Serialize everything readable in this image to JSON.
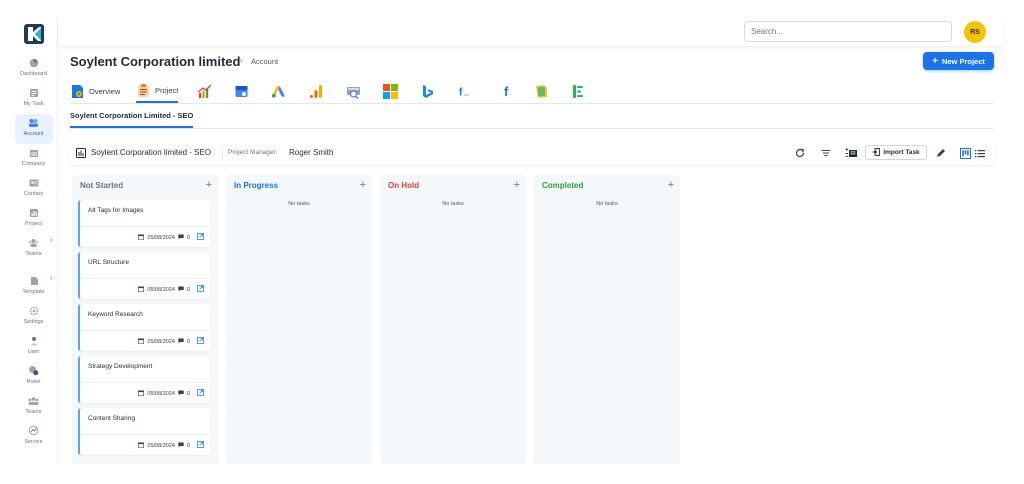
{
  "sidebar": {
    "items": [
      {
        "label": "Dashboard",
        "icon": "dashboard-icon"
      },
      {
        "label": "My Task",
        "icon": "task-list-icon"
      },
      {
        "label": "Account",
        "icon": "account-icon",
        "active": true
      },
      {
        "label": "Company",
        "icon": "company-icon"
      },
      {
        "label": "Contact",
        "icon": "contact-icon"
      },
      {
        "label": "Project",
        "icon": "project-icon"
      },
      {
        "label": "Teams",
        "icon": "teams-icon",
        "expandable": true
      },
      {
        "label": "Template",
        "icon": "template-icon",
        "expandable": true
      },
      {
        "label": "Settings",
        "icon": "settings-icon"
      },
      {
        "label": "User",
        "icon": "user-icon"
      },
      {
        "label": "Roles",
        "icon": "roles-icon"
      },
      {
        "label": "Teams",
        "icon": "teams-group-icon"
      },
      {
        "label": "Service",
        "icon": "service-icon"
      }
    ]
  },
  "header": {
    "search_placeholder": "Search...",
    "avatar_initials": "RS"
  },
  "page": {
    "title": "Soylent Corporation limited",
    "breadcrumb": "Account",
    "new_project_label": "New Project"
  },
  "tabs": [
    {
      "label": "Overview",
      "icon": "overview-icon"
    },
    {
      "label": "Project",
      "icon": "project-clipboard-icon",
      "active": true
    }
  ],
  "integration_icons": [
    "growth-chart-icon",
    "google-my-business-icon",
    "google-ads-icon",
    "google-analytics-icon",
    "search-console-icon",
    "microsoft-icon",
    "bing-icon",
    "facebook-ads-icon",
    "facebook-icon",
    "google-sheets-icon",
    "tag-manager-icon"
  ],
  "subtab": "Soylent Corporation Limited - SEO",
  "project_bar": {
    "name": "Soylent Corporation limited - SEO",
    "manager_label": "Project Manager:",
    "manager_name": "Roger Smith",
    "import_label": "Import Task"
  },
  "board": {
    "columns": [
      {
        "title": "Not Started",
        "color": "#6b7280"
      },
      {
        "title": "In Progress",
        "color": "#1a73e8",
        "empty": "No tasks"
      },
      {
        "title": "On Hold",
        "color": "#e53935",
        "empty": "No tasks"
      },
      {
        "title": "Completed",
        "color": "#2e9e46",
        "empty": "No tasks"
      }
    ],
    "cards": [
      {
        "title": "Alt Tags for Images",
        "date": "05/08/2024",
        "comments": "0"
      },
      {
        "title": "URL Structure",
        "date": "05/08/2024",
        "comments": "0"
      },
      {
        "title": "Keyword Research",
        "date": "05/08/2024",
        "comments": "0"
      },
      {
        "title": "Strategy Development",
        "date": "05/08/2024",
        "comments": "0"
      },
      {
        "title": "Content Sharing",
        "date": "05/08/2024",
        "comments": "0"
      }
    ]
  },
  "colors": {
    "primary": "#1a73e8",
    "avatar": "#f5c400",
    "column_bg": "#f5f8fb"
  }
}
